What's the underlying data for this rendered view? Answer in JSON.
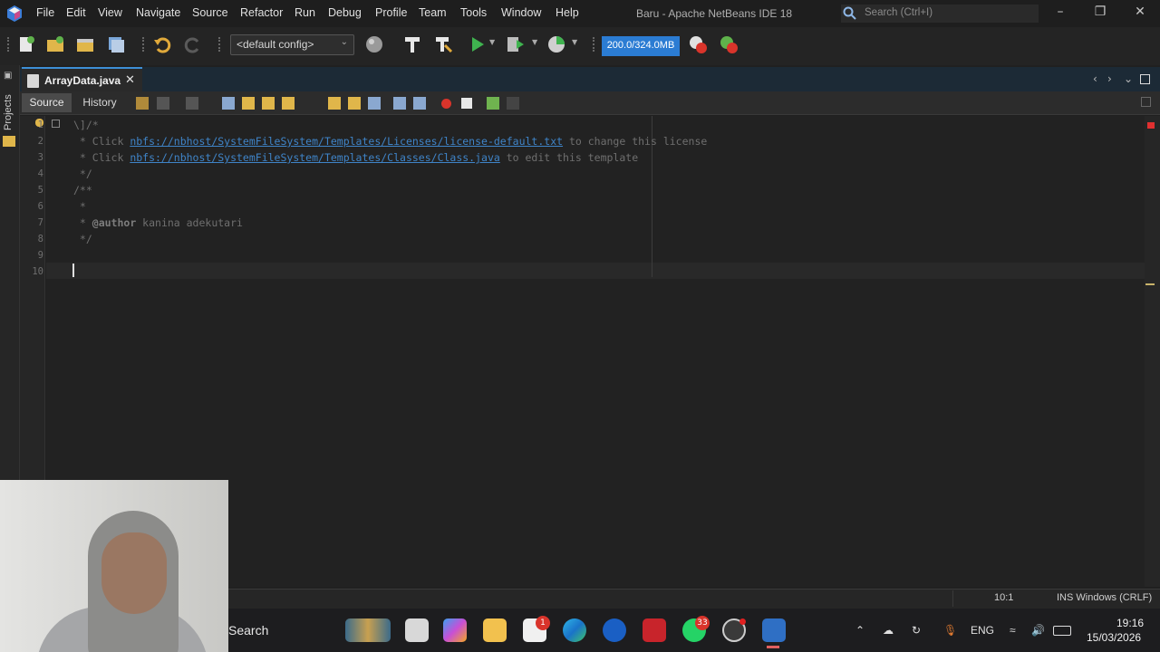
{
  "menu": {
    "items": [
      "File",
      "Edit",
      "View",
      "Navigate",
      "Source",
      "Refactor",
      "Run",
      "Debug",
      "Profile",
      "Team",
      "Tools",
      "Window",
      "Help"
    ],
    "window_title": "Baru - Apache NetBeans IDE 18",
    "search_placeholder": "Search (Ctrl+I)"
  },
  "toolbar": {
    "config": "<default config>",
    "memory": "200.0/324.0MB"
  },
  "sidebar": {
    "projects_label": "Projects"
  },
  "editor_tab": {
    "filename": "ArrayData.java",
    "close": "✕"
  },
  "editor_toolbar": {
    "source_label": "Source",
    "history_label": "History"
  },
  "code": {
    "lines": [
      {
        "no": "1",
        "prefix": "\\]/*",
        "link": "",
        "suffix": ""
      },
      {
        "no": "2",
        "prefix": " * Click ",
        "link": "nbfs://nbhost/SystemFileSystem/Templates/Licenses/license-default.txt",
        "suffix": " to change this license"
      },
      {
        "no": "3",
        "prefix": " * Click ",
        "link": "nbfs://nbhost/SystemFileSystem/Templates/Classes/Class.java",
        "suffix": " to edit this template"
      },
      {
        "no": "4",
        "prefix": " */",
        "link": "",
        "suffix": ""
      },
      {
        "no": "5",
        "prefix": "/**",
        "link": "",
        "suffix": ""
      },
      {
        "no": "6",
        "prefix": " *",
        "link": "",
        "suffix": ""
      },
      {
        "no": "7",
        "prefix": " * ",
        "tag": "@author",
        "suffix": " kanina adekutari"
      },
      {
        "no": "8",
        "prefix": " */",
        "link": "",
        "suffix": ""
      },
      {
        "no": "9",
        "prefix": "",
        "link": "",
        "suffix": ""
      },
      {
        "no": "10",
        "prefix": "",
        "link": "",
        "suffix": ""
      }
    ]
  },
  "status": {
    "caret_position": "10:1",
    "insert_mode": "INS Windows (CRLF)"
  },
  "taskbar": {
    "search_label": "Search",
    "whatsapp_badge": "33",
    "store_badge": "1",
    "language": "ENG",
    "time": "19:16",
    "date": "15/03/2026"
  },
  "colors": {
    "accent": "#2b7cd3",
    "link": "#3f84c8",
    "error": "#e03030"
  }
}
